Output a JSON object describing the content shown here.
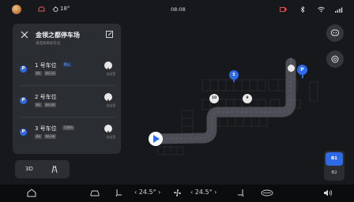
{
  "status_bar": {
    "temperature": "18°",
    "time": "08:08"
  },
  "panel": {
    "title": "金领之都停车场",
    "subtitle": "请选择目标车位",
    "slots": [
      {
        "name": "1 号车位",
        "tag": "默认",
        "chips": [
          "B1",
          "B1-12"
        ],
        "nav_label": "去这里"
      },
      {
        "name": "2 号车位",
        "tag": "",
        "chips": [
          "B1",
          "B1-05"
        ],
        "nav_label": "去这里"
      },
      {
        "name": "3 号车位",
        "tag": "可预约",
        "chips": [
          "B2",
          "B2-08"
        ],
        "nav_label": "去这里"
      }
    ]
  },
  "view_toggle": {
    "mode_3d": "3D"
  },
  "floors": {
    "current": "B1",
    "other": "B2"
  },
  "map_markers": {
    "slot_5": "5",
    "slot_10": "10",
    "slot_9": "9"
  },
  "bottom_bar": {
    "left_temp": "24.5°",
    "right_temp": "24.5°"
  },
  "colors": {
    "accent": "#2f6ae6",
    "panel_bg": "#2c2e32",
    "map_bg": "#16181b"
  },
  "icons": [
    "avatar",
    "car-icon",
    "weather-icon",
    "close-icon",
    "edit-icon",
    "parking-icon",
    "navigate-icon",
    "road-icon",
    "chat-icon",
    "settings-icon",
    "home-icon",
    "seat-icon",
    "fan-icon",
    "volume-icon"
  ]
}
